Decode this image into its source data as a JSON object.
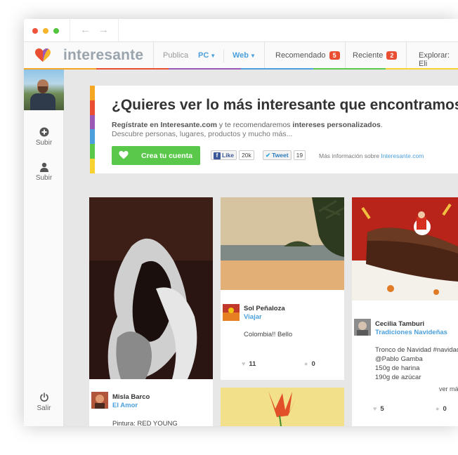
{
  "browser": {
    "back_glyph": "←",
    "forward_glyph": "→"
  },
  "brand": {
    "name": "interesante",
    "colors": [
      "#f5a623",
      "#e94e32",
      "#9b59b6",
      "#4a9fdc",
      "#5ac84a",
      "#f7d231"
    ]
  },
  "topnav": {
    "publica_label": "Publica",
    "pc_label": "PC",
    "web_label": "Web",
    "recomendado_label": "Recomendado",
    "recomendado_count": "5",
    "reciente_label": "Reciente",
    "reciente_count": "2",
    "explorar_label": "Explorar: Eli"
  },
  "sidebar": {
    "upload_label": "Subir",
    "user_label": "Subir",
    "logout_label": "Salir"
  },
  "hero": {
    "title": "¿Quieres ver lo más interesante que encontramos par",
    "line1_a": "Regístrate en Interesante.com",
    "line1_b": " y te recomendaremos ",
    "line1_c": "intereses personalizados",
    "line1_d": ".",
    "line2": "Descubre personas, lugares, productos y mucho más...",
    "cta_label": "Crea tu cuenta",
    "fb_label": "Like",
    "fb_count": "20k",
    "tweet_label": "Tweet",
    "tweet_count": "19",
    "more_info_prefix": "Más información sobre ",
    "more_info_link": "Interesante.com"
  },
  "cards": [
    {
      "user": "Misla Barco",
      "category": "El Amor",
      "text": "Pintura: RED YOUNG"
    },
    {
      "user": "Sol Peñaloza",
      "category": "Viajar",
      "text": "Colombia!! Bello",
      "likes": "11",
      "comments": "0"
    },
    {
      "user": "Cecilia Tamburi",
      "category": "Tradiciones Navideñas",
      "lines": [
        "Tronco de Navidad #navidad",
        "@Pablo Gamba",
        "150g de harina",
        "190g de azúcar"
      ],
      "read_more": "ver má",
      "likes": "5",
      "comments": "0"
    }
  ]
}
